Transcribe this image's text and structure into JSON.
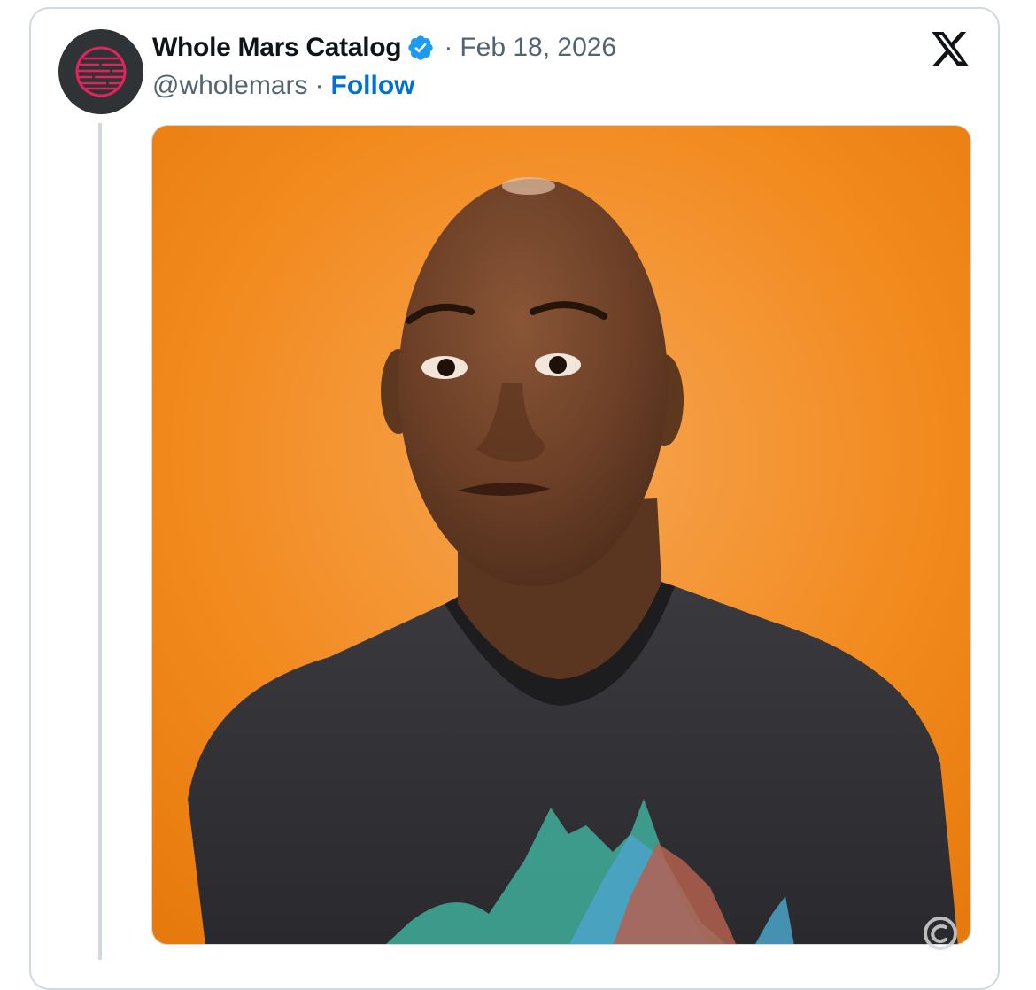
{
  "post": {
    "author_name": "Whole Mars Catalog",
    "handle": "@wholemars",
    "separator": "·",
    "date": "Feb 18, 2026",
    "follow_label": "Follow",
    "verified": true
  },
  "icons": {
    "avatar": "mars-planet-icon",
    "verified": "verified-badge-icon",
    "brand": "x-logo-icon",
    "watermark": "watermark-logo-icon"
  },
  "media": {
    "description_free": true
  },
  "colors": {
    "accent": "#006fd6",
    "verified": "#1d9bf0",
    "text_primary": "#0f1419",
    "text_secondary": "#536471",
    "border": "#cfd9de",
    "photo_background": "#f28a1e",
    "avatar_bg": "#2f3336",
    "avatar_mark": "#e0245e"
  }
}
